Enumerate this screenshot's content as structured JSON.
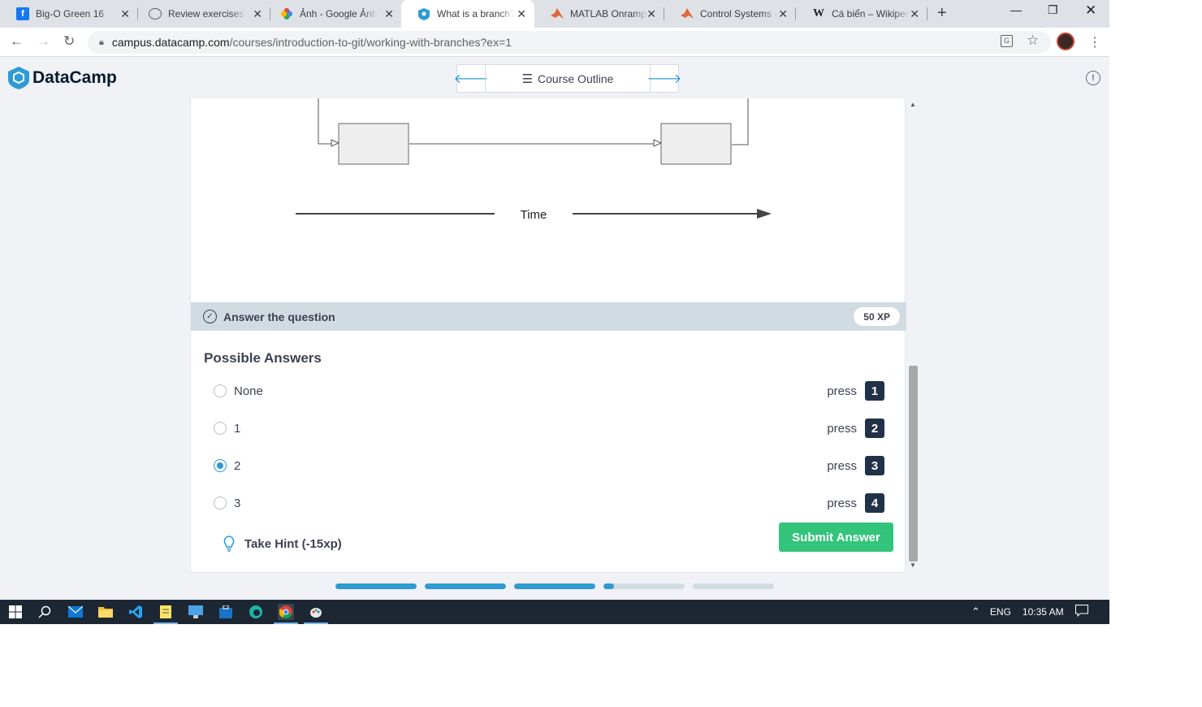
{
  "browser": {
    "tabs": [
      {
        "title": "Big-O Green 16",
        "icon": "facebook-icon"
      },
      {
        "title": "Review exercises for",
        "icon": "globe-icon"
      },
      {
        "title": "Ảnh - Google Ảnh",
        "icon": "google-photos-icon"
      },
      {
        "title": "What is a branch?",
        "icon": "datacamp-icon"
      },
      {
        "title": "MATLAB Onramp",
        "icon": "matlab-icon"
      },
      {
        "title": "Control Systems -",
        "icon": "matlab-icon"
      },
      {
        "title": "Cá biển – Wikipedia",
        "icon": "wikipedia-icon"
      }
    ],
    "active_tab": 3,
    "url_host": "campus.datacamp.com",
    "url_path": "/courses/introduction-to-git/working-with-branches?ex=1"
  },
  "header": {
    "logo": "DataCamp",
    "course_outline": "Course Outline"
  },
  "diagram": {
    "time_label": "Time"
  },
  "question": {
    "label": "Answer the question",
    "xp": "50 XP",
    "possible_answers_title": "Possible Answers",
    "answers": [
      {
        "text": "None",
        "press": "press",
        "key": "1"
      },
      {
        "text": "1",
        "press": "press",
        "key": "2"
      },
      {
        "text": "2",
        "press": "press",
        "key": "3"
      },
      {
        "text": "3",
        "press": "press",
        "key": "4"
      }
    ],
    "selected_index": 2,
    "hint": "Take Hint (-15xp)",
    "submit": "Submit Answer"
  },
  "progress": [
    1,
    1,
    1,
    0.13,
    0
  ],
  "taskbar": {
    "language": "ENG",
    "time": "10:35 AM"
  },
  "colors": {
    "accent": "#2f9ad4",
    "submit": "#33c47c",
    "key_badge": "#213147",
    "taskbar": "#1c2733"
  }
}
